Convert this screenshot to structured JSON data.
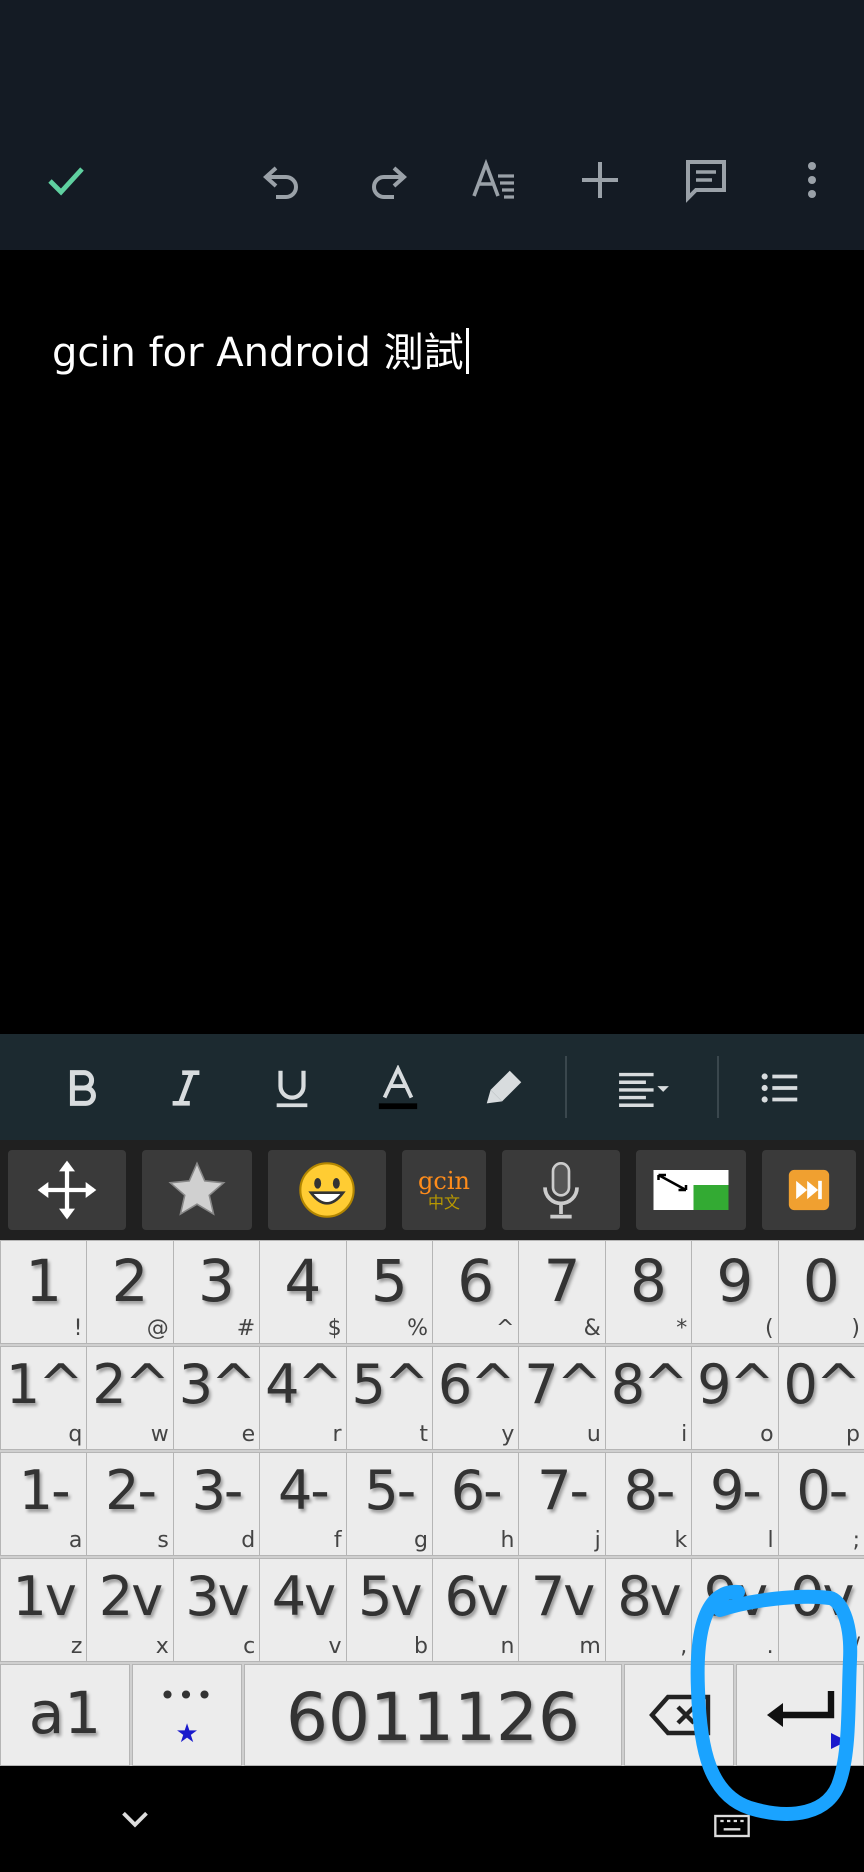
{
  "editor": {
    "text": "gcin for Android 測試"
  },
  "keyboard": {
    "rows": [
      [
        {
          "main": "1",
          "sub": "!"
        },
        {
          "main": "2",
          "sub": "@"
        },
        {
          "main": "3",
          "sub": "#"
        },
        {
          "main": "4",
          "sub": "$"
        },
        {
          "main": "5",
          "sub": "%"
        },
        {
          "main": "6",
          "sub": "^"
        },
        {
          "main": "7",
          "sub": "&"
        },
        {
          "main": "8",
          "sub": "*"
        },
        {
          "main": "9",
          "sub": "("
        },
        {
          "main": "0",
          "sub": ")"
        }
      ],
      [
        {
          "main": "1^",
          "sub": "q"
        },
        {
          "main": "2^",
          "sub": "w"
        },
        {
          "main": "3^",
          "sub": "e"
        },
        {
          "main": "4^",
          "sub": "r"
        },
        {
          "main": "5^",
          "sub": "t"
        },
        {
          "main": "6^",
          "sub": "y"
        },
        {
          "main": "7^",
          "sub": "u"
        },
        {
          "main": "8^",
          "sub": "i"
        },
        {
          "main": "9^",
          "sub": "o"
        },
        {
          "main": "0^",
          "sub": "p"
        }
      ],
      [
        {
          "main": "1-",
          "sub": "a"
        },
        {
          "main": "2-",
          "sub": "s"
        },
        {
          "main": "3-",
          "sub": "d"
        },
        {
          "main": "4-",
          "sub": "f"
        },
        {
          "main": "5-",
          "sub": "g"
        },
        {
          "main": "6-",
          "sub": "h"
        },
        {
          "main": "7-",
          "sub": "j"
        },
        {
          "main": "8-",
          "sub": "k"
        },
        {
          "main": "9-",
          "sub": "l"
        },
        {
          "main": "0-",
          "sub": ";"
        }
      ],
      [
        {
          "main": "1v",
          "sub": "z"
        },
        {
          "main": "2v",
          "sub": "x"
        },
        {
          "main": "3v",
          "sub": "c"
        },
        {
          "main": "4v",
          "sub": "v"
        },
        {
          "main": "5v",
          "sub": "b"
        },
        {
          "main": "6v",
          "sub": "n"
        },
        {
          "main": "7v",
          "sub": "m"
        },
        {
          "main": "8v",
          "sub": ","
        },
        {
          "main": "9v",
          "sub": "."
        },
        {
          "main": "0v",
          "sub": "/"
        }
      ]
    ],
    "bottom": {
      "mode_label": "a1",
      "dots_label": "•••",
      "star_label": "★",
      "space_label": "6011126"
    },
    "gcin_logo": {
      "top": "gcin",
      "bottom": "中文"
    }
  },
  "colors": {
    "accent_check": "#5fd0a0",
    "annotation": "#1aa3ff"
  },
  "icons": {
    "top": [
      "check-icon",
      "undo-icon",
      "redo-icon",
      "text-format-icon",
      "add-icon",
      "comment-icon",
      "more-vert-icon"
    ],
    "fmt": [
      "bold-icon",
      "italic-icon",
      "underline-icon",
      "text-color-icon",
      "highlighter-icon",
      "align-icon",
      "list-icon"
    ],
    "tool": [
      "move-arrows-icon",
      "star-icon",
      "emoji-icon",
      "gcin-logo-icon",
      "microphone-icon",
      "resize-icon",
      "fast-forward-icon"
    ],
    "nav": [
      "chevron-down-icon",
      "keyboard-switch-icon"
    ]
  }
}
